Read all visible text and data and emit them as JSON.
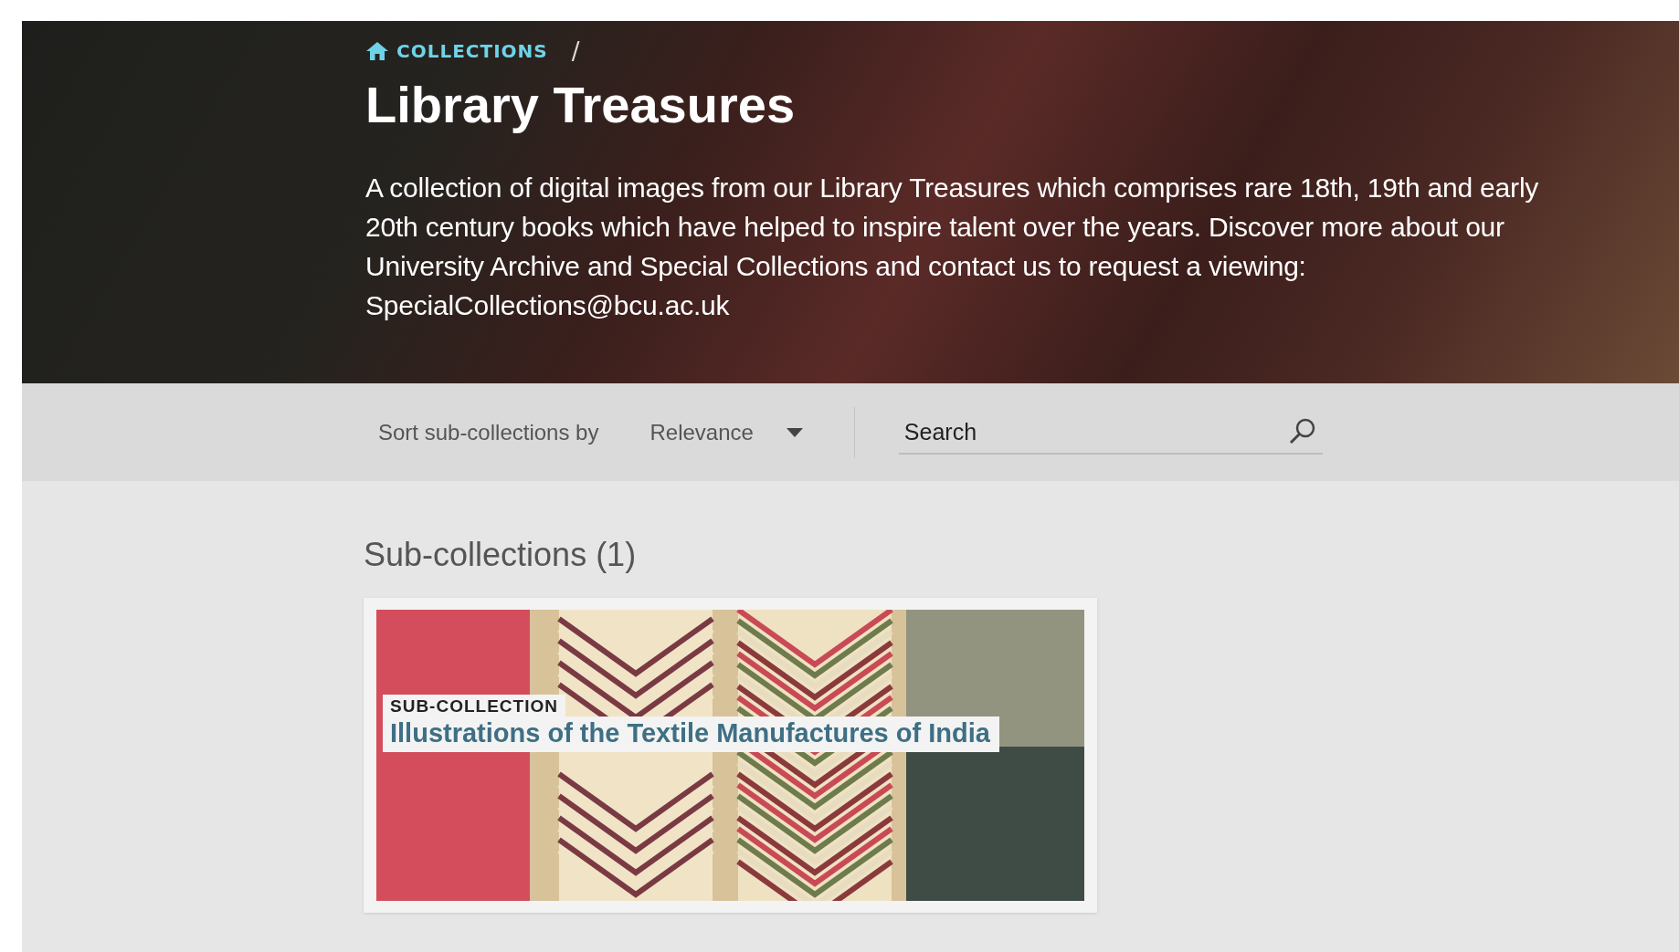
{
  "breadcrumb": {
    "link": "COLLECTIONS",
    "separator": "/"
  },
  "header": {
    "title": "Library Treasures",
    "description": "A collection of digital images from our Library Treasures which comprises rare 18th, 19th and early 20th century books which have helped to inspire talent over the years. Discover more about our University Archive and Special Collections and contact us to request a viewing: SpecialCollections@bcu.ac.uk"
  },
  "toolbar": {
    "sort_label": "Sort sub-collections by",
    "sort_value": "Relevance",
    "search": {
      "placeholder": "Search"
    }
  },
  "section": {
    "heading": "Sub-collections (1)"
  },
  "cards": [
    {
      "kind": "sub-collection",
      "tag": "SUB-COLLECTION",
      "title": "Illustrations of the Textile Manufactures of India"
    }
  ]
}
